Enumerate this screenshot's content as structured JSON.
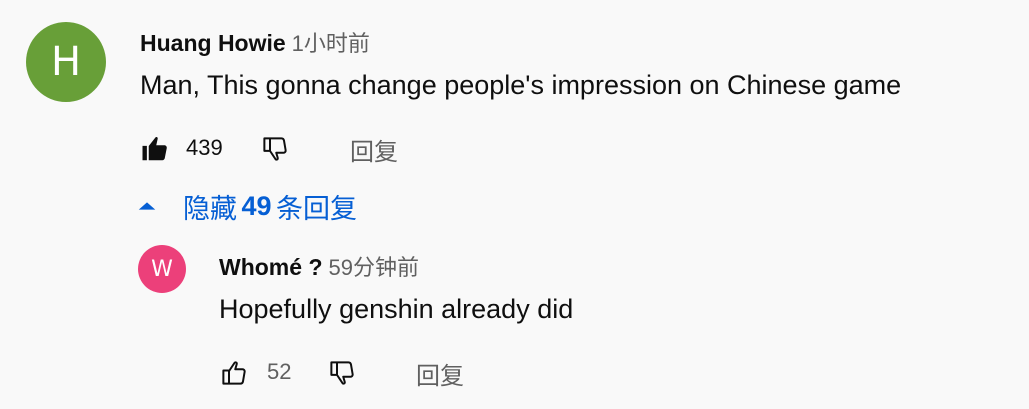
{
  "comment": {
    "avatar_letter": "H",
    "avatar_color": "#689f38",
    "author": "Huang Howie",
    "time": "1小时前",
    "text": "Man, This gonna change people's impression on Chinese game",
    "likes": "439",
    "liked": true,
    "reply_label": "回复",
    "icons": {
      "like": "thumbs-up-filled-icon",
      "dislike": "thumbs-down-icon"
    }
  },
  "replies_toggle": {
    "icon": "triangle-up-icon",
    "prefix": "隐藏",
    "count": "49",
    "suffix": "条回复",
    "color": "#065fd4"
  },
  "reply": {
    "avatar_letter": "W",
    "avatar_color": "#ec407a",
    "author": "Whomé ?",
    "time": "59分钟前",
    "text": "Hopefully genshin already did",
    "likes": "52",
    "liked": false,
    "reply_label": "回复",
    "icons": {
      "like": "thumbs-up-outline-icon",
      "dislike": "thumbs-down-icon"
    }
  }
}
